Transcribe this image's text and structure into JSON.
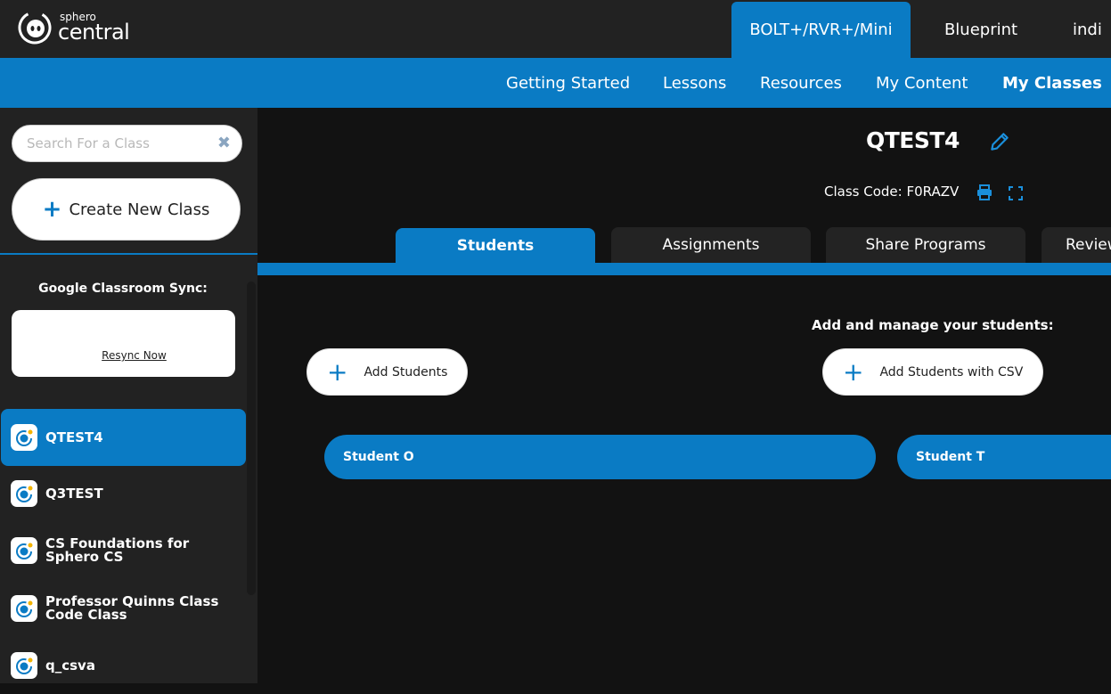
{
  "header": {
    "logo": {
      "small": "sphero",
      "big": "central"
    },
    "product_tabs": [
      {
        "label": "BOLT+/RVR+/Mini",
        "active": true
      },
      {
        "label": "Blueprint",
        "active": false
      },
      {
        "label": "indi",
        "active": false
      }
    ]
  },
  "nav": {
    "items": [
      {
        "label": "Getting Started",
        "active": false
      },
      {
        "label": "Lessons",
        "active": false
      },
      {
        "label": "Resources",
        "active": false
      },
      {
        "label": "My Content",
        "active": false
      },
      {
        "label": "My Classes",
        "active": true
      }
    ]
  },
  "sidebar": {
    "search": {
      "placeholder": "Search For a Class",
      "value": ""
    },
    "create_label": "Create New Class",
    "sync": {
      "label": "Google Classroom Sync:",
      "resync_label": "Resync Now"
    },
    "classes": [
      {
        "name": "QTEST4",
        "active": true
      },
      {
        "name": "Q3TEST",
        "active": false
      },
      {
        "name": "CS Foundations for Sphero CS",
        "active": false
      },
      {
        "name": "Professor Quinns Class Code Class",
        "active": false
      },
      {
        "name": "q_csva",
        "active": false
      }
    ]
  },
  "main": {
    "title": "QTEST4",
    "class_code": "Class Code: F0RAZV",
    "tabs": [
      {
        "label": "Students",
        "active": true
      },
      {
        "label": "Assignments",
        "active": false
      },
      {
        "label": "Share Programs",
        "active": false
      },
      {
        "label": "Review",
        "active": false
      }
    ],
    "manage_label": "Add and manage your students:",
    "add_students_label": "Add Students",
    "add_csv_label": "Add Students with CSV",
    "students": [
      "Student O",
      "Student T"
    ]
  },
  "colors": {
    "accent": "#0a7bc4",
    "topbar": "#222222",
    "background": "#121212"
  }
}
